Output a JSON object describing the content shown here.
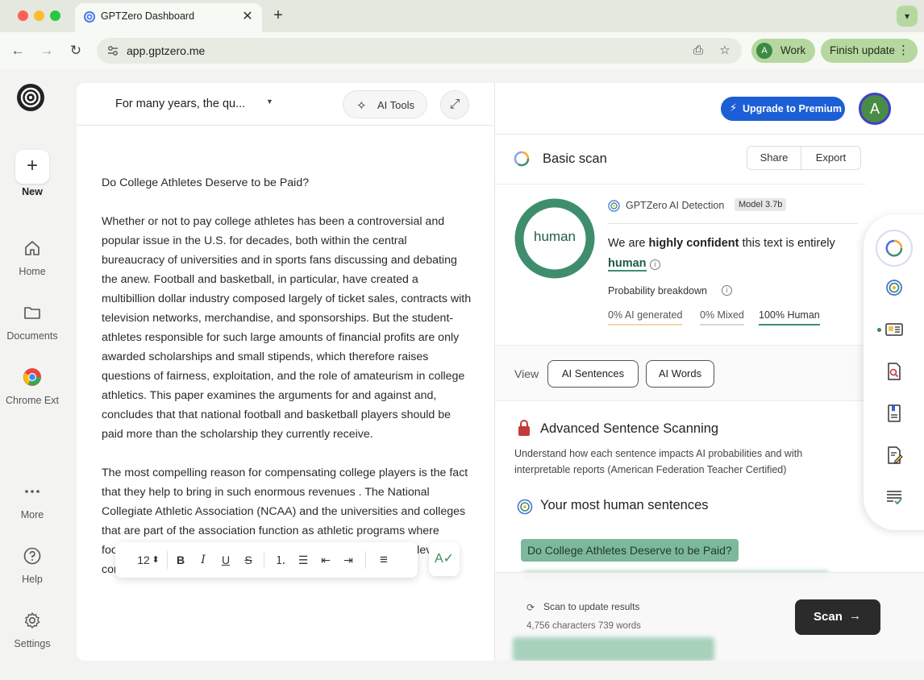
{
  "browser": {
    "tab_title": "GPTZero Dashboard",
    "tab_close": "✕",
    "new_tab": "+",
    "tab_menu": "▾",
    "url": "app.gptzero.me",
    "profile_initial": "A",
    "profile_label": "Work",
    "update_label": "Finish update",
    "update_menu": "⋮",
    "nav": {
      "back": "←",
      "forward": "→",
      "reload": "↻"
    },
    "icons": {
      "install": "⎙",
      "bookmark": "☆"
    }
  },
  "sidebar": {
    "new_label": "New",
    "new_icon": "+",
    "items": [
      {
        "label": "Home",
        "icon": "home-icon"
      },
      {
        "label": "Documents",
        "icon": "folder-icon"
      },
      {
        "label": "Chrome Ext",
        "icon": "chrome-icon"
      },
      {
        "label": "More",
        "icon": "more-icon"
      },
      {
        "label": "Help",
        "icon": "help-icon"
      },
      {
        "label": "Settings",
        "icon": "gear-icon"
      }
    ]
  },
  "editor": {
    "doc_title": "For many years, the qu...",
    "doc_caret": "▼",
    "ai_tools_icon": "✧",
    "ai_tools_label": "AI Tools",
    "expand_icon": "⤢",
    "paragraphs": [
      "Do College Athletes Deserve to be Paid?",
      "Whether or not to pay college athletes has been a controversial and popular issue in the U.S. for decades, both within the central bureaucracy of universities and in sports fans discussing and debating the anew. Football and basketball, in particular, have created a multibillion dollar industry composed largely of ticket sales, contracts with television networks, merchandise, and sponsorships. But the student-athletes responsible for such large amounts of financial profits are only awarded scholarships and small stipends, which therefore raises questions of fairness, exploitation, and the role of amateurism in college athletics. This paper examines the arguments for and against and, concludes that that national football and basketball players should be paid more than the scholarship they currently receive.",
      "The most compelling reason for compensating college players is the fact that they help to bring in such enormous revenues . The National Collegiate Athletic Association (NCAA) and the universities and colleges that are part of the association function as athletic programs where football and basketball games generate millions of dollars in television contracts and"
    ],
    "format_bar": {
      "font_size": "12",
      "font_size_arrows": "⬍",
      "bold": "B",
      "italic": "I",
      "underline": "U",
      "strike": "S",
      "ordered": "⒈",
      "bullets": "☰",
      "outdent": "⇤",
      "indent": "⇥",
      "align": "≡"
    },
    "spell_icon": "A✓"
  },
  "results": {
    "upgrade_icon": "⚡",
    "upgrade_label": "Upgrade to Premium",
    "avatar_initial": "A",
    "scan_title": "Basic scan",
    "share_label": "Share",
    "export_label": "Export",
    "score_label": "human",
    "detection_title": "GPTZero AI Detection",
    "model_badge": "Model 3.7b",
    "confidence_prefix": "We are ",
    "confidence_bold": "highly confident",
    "confidence_suffix": " this text is entirely",
    "confidence_result": "human",
    "info_icon": "i",
    "probability_title": "Probability breakdown",
    "breakdown": {
      "ai": "0% AI generated",
      "mixed": "0% Mixed",
      "human": "100% Human"
    },
    "human_probability": 1.0,
    "view_label": "View",
    "view_buttons": [
      "AI Sentences",
      "AI Words"
    ],
    "advanced_title": "Advanced Sentence Scanning",
    "advanced_desc": "Understand how each sentence impacts AI probabilities and with interpretable reports (American Federation Teacher Certified)",
    "most_human_title": "Your most human sentences",
    "top_sentence": "Do College Athletes Deserve to be Paid?",
    "update_icon": "⟳",
    "update_text": "Scan to update results",
    "counts": "4,756 characters 739 words",
    "scan_label": "Scan",
    "scan_arrow": "→"
  },
  "colors": {
    "accent_green": "#3e8e6e",
    "upgrade_blue": "#1c5ed6",
    "scan_dark": "#2b2b2b"
  }
}
